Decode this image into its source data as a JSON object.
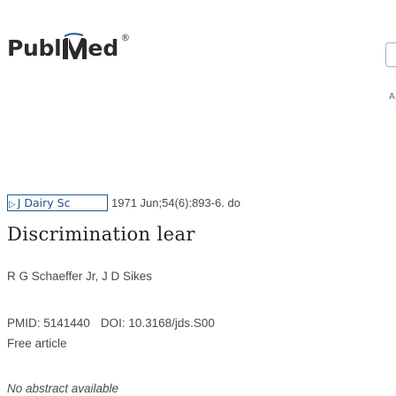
{
  "header": {
    "logo": {
      "text_left": "Publ",
      "text_right": "ed",
      "registered_mark": "®",
      "mark_icon": "pubmed-bookmark-icon"
    },
    "advanced_link_fragment": "A"
  },
  "article": {
    "journal_button_label": "J Dairy Sc",
    "citation": "1971 Jun;54(6):893-6. do",
    "title": "Discrimination lear",
    "authors": "R G Schaeffer Jr, J D Sikes",
    "pmid": "PMID: 5141440",
    "doi": "DOI: 10.3168/jds.S00",
    "free_article": "Free article",
    "no_abstract": "No abstract available"
  },
  "colors": {
    "logo_text": "#2b2b2b",
    "link_blue": "#20558a",
    "body_text": "#4a4a4a",
    "title_text": "#212121"
  }
}
